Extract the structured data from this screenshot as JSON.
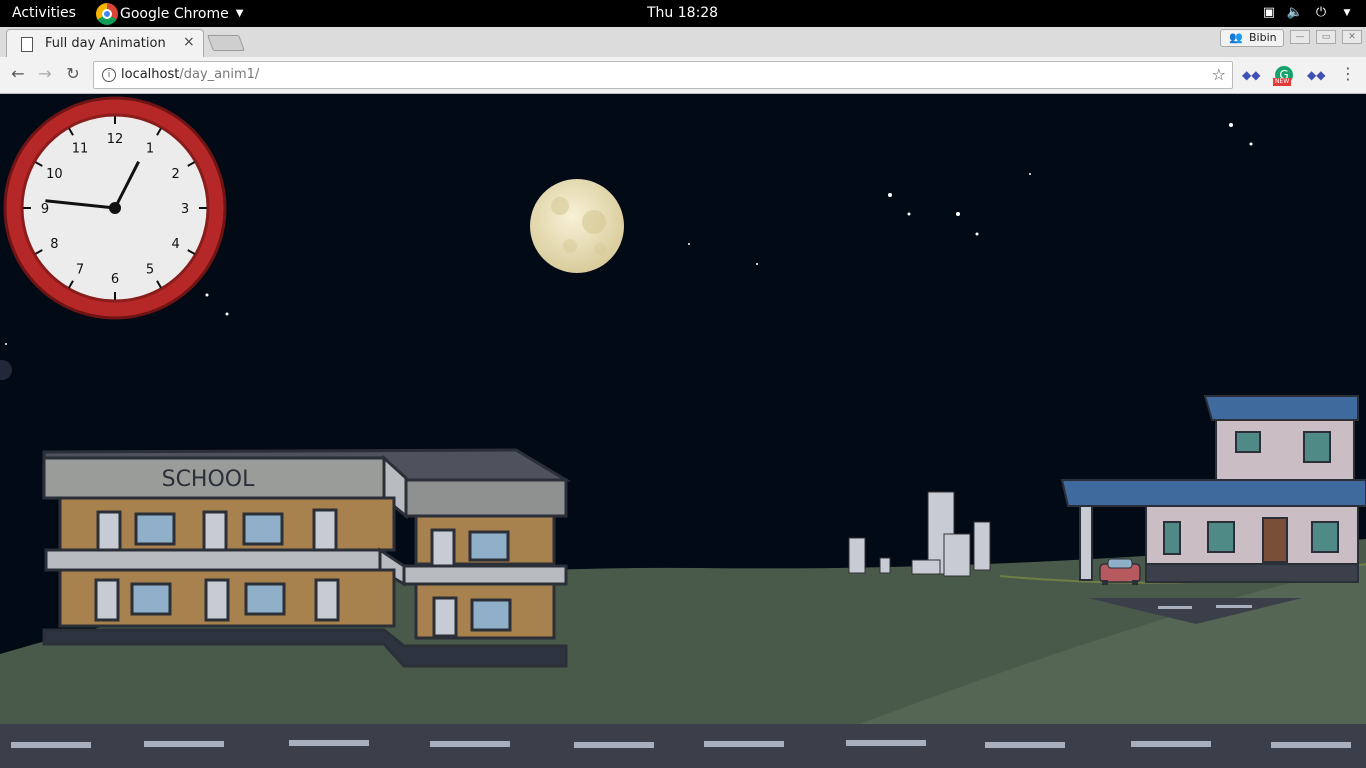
{
  "system_bar": {
    "activities": "Activities",
    "app_name": "Google Chrome",
    "clock": "Thu 18:28"
  },
  "browser": {
    "tab_title": "Full day Animation",
    "tab_close": "×",
    "profile_name": "Bibin",
    "url_host": "localhost",
    "url_path": "/day_anim1/"
  },
  "scene": {
    "school_sign": "SCHOOL",
    "clock_numbers": [
      "12",
      "1",
      "2",
      "3",
      "4",
      "5",
      "6",
      "7",
      "8",
      "9",
      "10",
      "11"
    ],
    "time_hour": 0.9,
    "time_minute": 46,
    "colors": {
      "sky": "#020a16",
      "moon": "#efe6c4",
      "hill": "#4a5a4a",
      "road": "#3a3f4a",
      "clock_frame": "#b62828",
      "school_wall": "#a8824e",
      "house_roof": "#3e6a9e"
    }
  }
}
